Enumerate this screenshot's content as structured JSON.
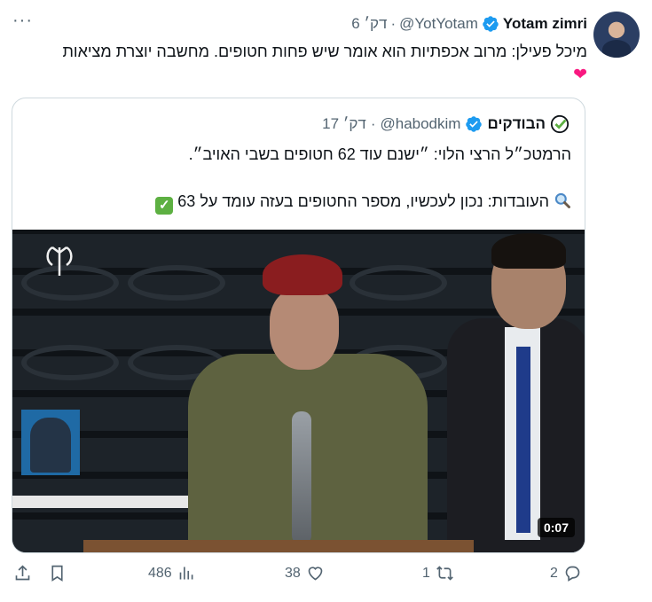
{
  "tweet": {
    "display_name": "Yotam zimri",
    "handle": "@YotYotam",
    "dot": "·",
    "time": "6 דק׳",
    "text_line": "מיכל פעילן: מרוב אכפתיות הוא אומר שיש פחות חטופים. מחשבה יוצרת מציאות",
    "emoji": "❤",
    "more": "···"
  },
  "quote": {
    "display_name": "הבודקים",
    "handle": "@habodkim",
    "dot": "·",
    "time": "17 דק׳",
    "line1": "הרמטכ״ל הרצי הלוי: ״ישנם עוד 62 חטופים בשבי האויב״.",
    "line2": "העובדות: נכון לעכשיו, מספר החטופים בעזה עומד על 63",
    "check_emoji": "✓",
    "video_duration": "0:07"
  },
  "actions": {
    "replies": "2",
    "retweets": "1",
    "likes": "38",
    "views": "486"
  },
  "colors": {
    "verified": "#1d9bf0",
    "heart": "#f91880",
    "check": "#5db042",
    "muted": "#536471"
  },
  "icons": [
    "more-icon",
    "verified-icon",
    "checkmark-logo-icon",
    "magnifier-icon",
    "reply-icon",
    "retweet-icon",
    "like-icon",
    "views-icon",
    "bookmark-icon",
    "share-icon"
  ]
}
